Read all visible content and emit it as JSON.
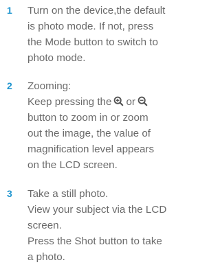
{
  "steps": [
    {
      "number": "1",
      "lines": [
        "Turn on the device,the default",
        "is photo mode. If not, press",
        "the Mode button to switch to",
        "photo mode."
      ]
    },
    {
      "number": "2",
      "lines": [
        "Zooming:",
        "Keep pressing the",
        "or",
        "button to zoom in or zoom",
        "out the image, the value of",
        "magnification level appears",
        "on the LCD screen."
      ],
      "icons": [
        "zoom-in-icon",
        "zoom-out-icon"
      ]
    },
    {
      "number": "3",
      "lines": [
        "Take a still photo.",
        "View your subject via the LCD",
        "screen.",
        "Press the Shot button to take",
        "a photo."
      ]
    }
  ],
  "colors": {
    "number": "#1f95cf",
    "text": "#6a6a6a",
    "icon": "#555555"
  }
}
